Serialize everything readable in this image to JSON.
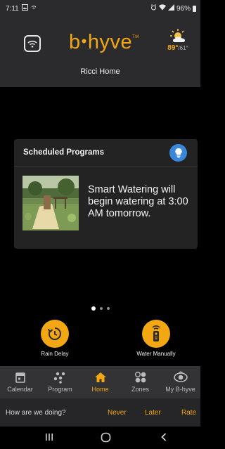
{
  "status_bar": {
    "time": "7:11",
    "battery": "96%"
  },
  "header": {
    "logo_text": "b",
    "logo_text_rest": "hyve",
    "logo_dot": "•",
    "logo_tm": "TM",
    "home_name": "Ricci Home",
    "weather": {
      "icon": "partly-sunny-icon",
      "high": "89°",
      "low": "/61°"
    }
  },
  "card": {
    "title": "Scheduled Programs",
    "message": "Smart Watering will begin watering at 3:00 AM tomorrow.",
    "info_icon": "lightbulb-icon",
    "accent": "#3a86d9"
  },
  "pager": {
    "pages": 3,
    "active": 0
  },
  "actions": [
    {
      "label": "Rain Delay",
      "icon": "timer-icon"
    },
    {
      "label": "Water Manually",
      "icon": "remote-icon"
    }
  ],
  "nav": [
    {
      "label": "Calendar",
      "icon": "calendar-icon",
      "active": false
    },
    {
      "label": "Program",
      "icon": "program-icon",
      "active": false
    },
    {
      "label": "Home",
      "icon": "home-icon",
      "active": true
    },
    {
      "label": "Zones",
      "icon": "zones-icon",
      "active": false
    },
    {
      "label": "My B-hyve",
      "icon": "my-bhyve-icon",
      "active": false
    }
  ],
  "feedback": {
    "question": "How are we doing?",
    "never": "Never",
    "later": "Later",
    "rate": "Rate"
  },
  "colors": {
    "brand": "#f3a712",
    "header_bg": "#2b2b2d",
    "nav_bg": "#333336"
  }
}
